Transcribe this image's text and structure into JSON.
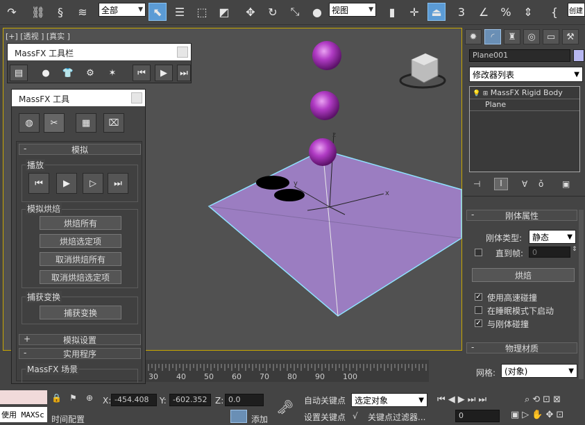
{
  "toolbar": {
    "filter_select": "全部",
    "coord_select": "视图",
    "snap_label": "3",
    "named_sel_label": "创建"
  },
  "viewport": {
    "label": "[+] [透视 ] [真实 ]",
    "axis_x": "x",
    "axis_y": "y",
    "axis_z": "z"
  },
  "massfx_toolbar": {
    "title": "MassFX 工具栏"
  },
  "massfx_tools": {
    "title": "MassFX 工具",
    "rollout_sim": "模拟",
    "group_play": "播放",
    "group_bake": "模拟烘焙",
    "bake_all": "烘焙所有",
    "bake_selected": "烘焙选定项",
    "unbake_all": "取消烘焙所有",
    "unbake_selected": "取消烘焙选定项",
    "group_capture": "捕获变换",
    "capture_btn": "捕获变换",
    "rollout_settings": "模拟设置",
    "rollout_utils": "实用程序",
    "scene_label": "MassFX 场景"
  },
  "right_panel": {
    "object_name": "Plane001",
    "modifier_list": "修改器列表",
    "stack_items": [
      "MassFX Rigid Body",
      "Plane"
    ],
    "rollout_rigid": "刚体属性",
    "rigid_type_label": "刚体类型:",
    "rigid_type_value": "静态",
    "until_frame_label": "直到帧:",
    "until_frame_value": "0",
    "bake_btn": "烘焙",
    "cb_high_velocity": "使用高速碰撞",
    "cb_sleep": "在睡眠模式下启动",
    "cb_collide": "与刚体碰撞",
    "rollout_material": "物理材质",
    "mesh_label": "网格:",
    "mesh_value": "(对象)"
  },
  "timeline": {
    "ticks": [
      "30",
      "40",
      "50",
      "60",
      "70",
      "80",
      "90",
      "100"
    ]
  },
  "status": {
    "maxscript": "使用 MAXSc",
    "x_label": "X:",
    "x_value": "-454.408",
    "y_label": "Y:",
    "y_value": "-602.352",
    "z_label": "Z:",
    "z_value": "0.0",
    "auto_key": "自动关键点",
    "set_key": "设置关键点",
    "selected_obj": "选定对象",
    "key_filter": "关键点过滤器...",
    "time_config": "时间配置",
    "add_label": "添加",
    "frame_value": "0"
  }
}
